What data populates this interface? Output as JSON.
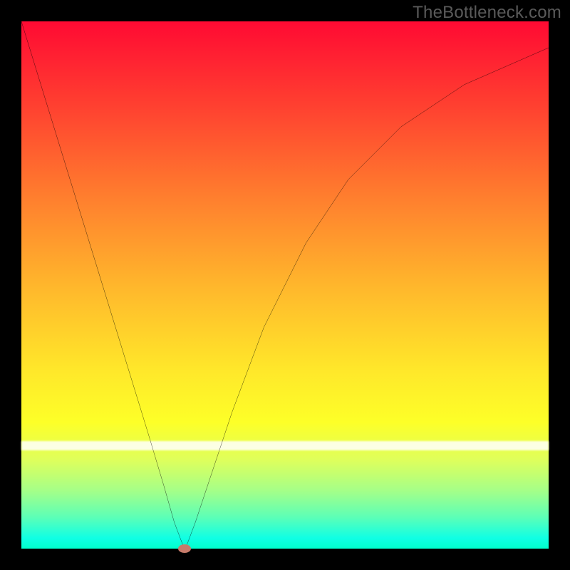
{
  "watermark": "TheBottleneck.com",
  "chart_data": {
    "type": "line",
    "title": "",
    "xlabel": "",
    "ylabel": "",
    "xlim": [
      0,
      100
    ],
    "ylim": [
      0,
      100
    ],
    "grid": false,
    "legend": false,
    "background": "gradient red-yellow-green (bottleneck severity)",
    "series": [
      {
        "name": "bottleneck-curve",
        "x": [
          0,
          4,
          8,
          12,
          16,
          20,
          24,
          27,
          29,
          30.5,
          31,
          31.5,
          33,
          36,
          40,
          46,
          54,
          62,
          72,
          84,
          100
        ],
        "y": [
          100,
          87,
          74,
          61,
          48,
          35,
          22,
          12,
          5,
          1,
          0,
          1,
          5,
          14,
          26,
          42,
          58,
          70,
          80,
          88,
          95
        ]
      }
    ],
    "marker": {
      "x": 31,
      "y": 0,
      "color": "#c77b6a"
    },
    "annotations": []
  },
  "colors": {
    "frame": "#000000",
    "curve": "#000000",
    "marker": "#c77b6a",
    "watermark": "#5a5a5a"
  }
}
